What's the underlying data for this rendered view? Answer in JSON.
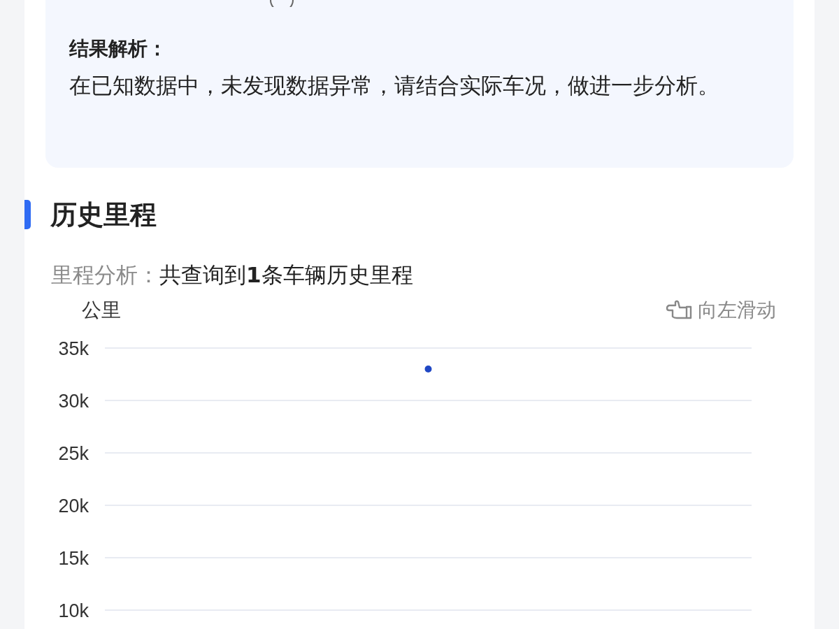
{
  "result_panel": {
    "heading": "结果解析：",
    "text": "在已知数据中，未发现数据异常，请结合实际车况，做进一步分析。"
  },
  "section": {
    "title": "历史里程",
    "summary_label": "里程分析：",
    "summary_value": "共查询到**1**条车辆历史里程",
    "unit": "公里",
    "swipe_hint": "向左滑动",
    "chart_data": {
      "type": "line",
      "categories": [
        null
      ],
      "grid": true,
      "series": [
        {
          "color": "#1f47c4",
          "marker": true,
          "values": [
            33000
          ]
        }
      ],
      "ylim": [
        10000,
        35000
      ],
      "yticks": [
        {
          "value": 10000,
          "label": "10k"
        },
        {
          "value": 15000,
          "label": "15k"
        },
        {
          "value": 20000,
          "label": "20k"
        },
        {
          "value": 25000,
          "label": "25k"
        },
        {
          "value": 30000,
          "label": "30k"
        },
        {
          "value": 35000,
          "label": "35k"
        }
      ]
    }
  }
}
